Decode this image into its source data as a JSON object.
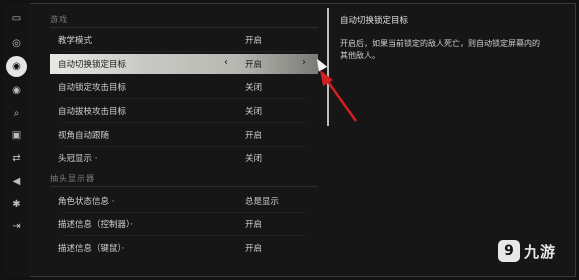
{
  "rail_icons": [
    {
      "name": "gamepad-icon",
      "glyph": "🎮"
    },
    {
      "name": "controller-icon",
      "glyph": "◎"
    },
    {
      "name": "settings-target-icon",
      "glyph": "◉",
      "active": true
    },
    {
      "name": "eye-icon",
      "glyph": "◉"
    },
    {
      "name": "search-icon",
      "glyph": "⌕"
    },
    {
      "name": "display-icon",
      "glyph": "▣"
    },
    {
      "name": "swap-icon",
      "glyph": "⇄"
    },
    {
      "name": "audio-icon",
      "glyph": "◀"
    },
    {
      "name": "accessibility-icon",
      "glyph": "✱"
    },
    {
      "name": "exit-icon",
      "glyph": "⇥"
    }
  ],
  "sections": {
    "game_header": "游戏",
    "tracker_header": "抽头显示器"
  },
  "rows": [
    {
      "label": "教学模式",
      "value": "开启"
    },
    {
      "label": "自动切换锁定目标",
      "value": "开启",
      "selected": true
    },
    {
      "label": "自动锁定攻击目标",
      "value": "关闭"
    },
    {
      "label": "自动拔枝攻击目标",
      "value": "关闭"
    },
    {
      "label": "视角自动跟随",
      "value": "开启"
    },
    {
      "label": "头冠显示 ·",
      "value": "关闭"
    },
    {
      "label": "角色状态信息 ·",
      "value": "总是显示"
    },
    {
      "label": "描述信息（控制器）·",
      "value": "开启"
    },
    {
      "label": "描述信息（键鼠）·",
      "value": "开启"
    }
  ],
  "selector": {
    "left": "‹",
    "right": "›"
  },
  "description": {
    "title": "自动切换锁定目标",
    "text": "开启后，如果当前锁定的敌人死亡，则自动锁定屏幕内的其他敌人。"
  },
  "watermark": {
    "mark": "9",
    "text": "九游"
  },
  "colors": {
    "annotation": "#d21f1f"
  }
}
